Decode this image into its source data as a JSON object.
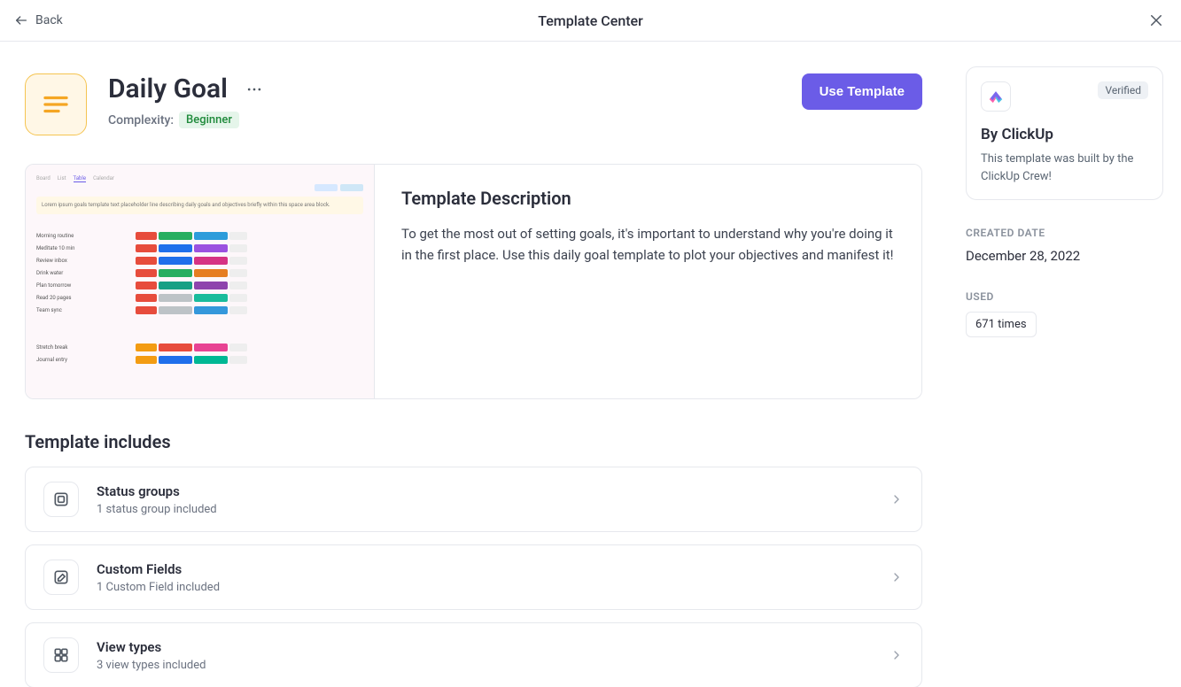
{
  "topbar": {
    "back_label": "Back",
    "title": "Template Center"
  },
  "template": {
    "title": "Daily Goal",
    "complexity_label": "Complexity:",
    "complexity_value": "Beginner",
    "use_button": "Use Template"
  },
  "description": {
    "heading": "Template Description",
    "body": "To get the most out of setting goals, it's important to understand why you're doing it in the first place. Use this daily goal template to plot your objectives and manifest it!"
  },
  "includes": {
    "heading": "Template includes",
    "items": [
      {
        "title": "Status groups",
        "subtitle": "1 status group included"
      },
      {
        "title": "Custom Fields",
        "subtitle": "1 Custom Field included"
      },
      {
        "title": "View types",
        "subtitle": "3 view types included"
      }
    ]
  },
  "sidebar": {
    "verified_label": "Verified",
    "author": "By ClickUp",
    "author_desc": "This template was built by the ClickUp Crew!",
    "created_label": "CREATED DATE",
    "created_value": "December 28, 2022",
    "used_label": "USED",
    "used_value": "671 times"
  }
}
